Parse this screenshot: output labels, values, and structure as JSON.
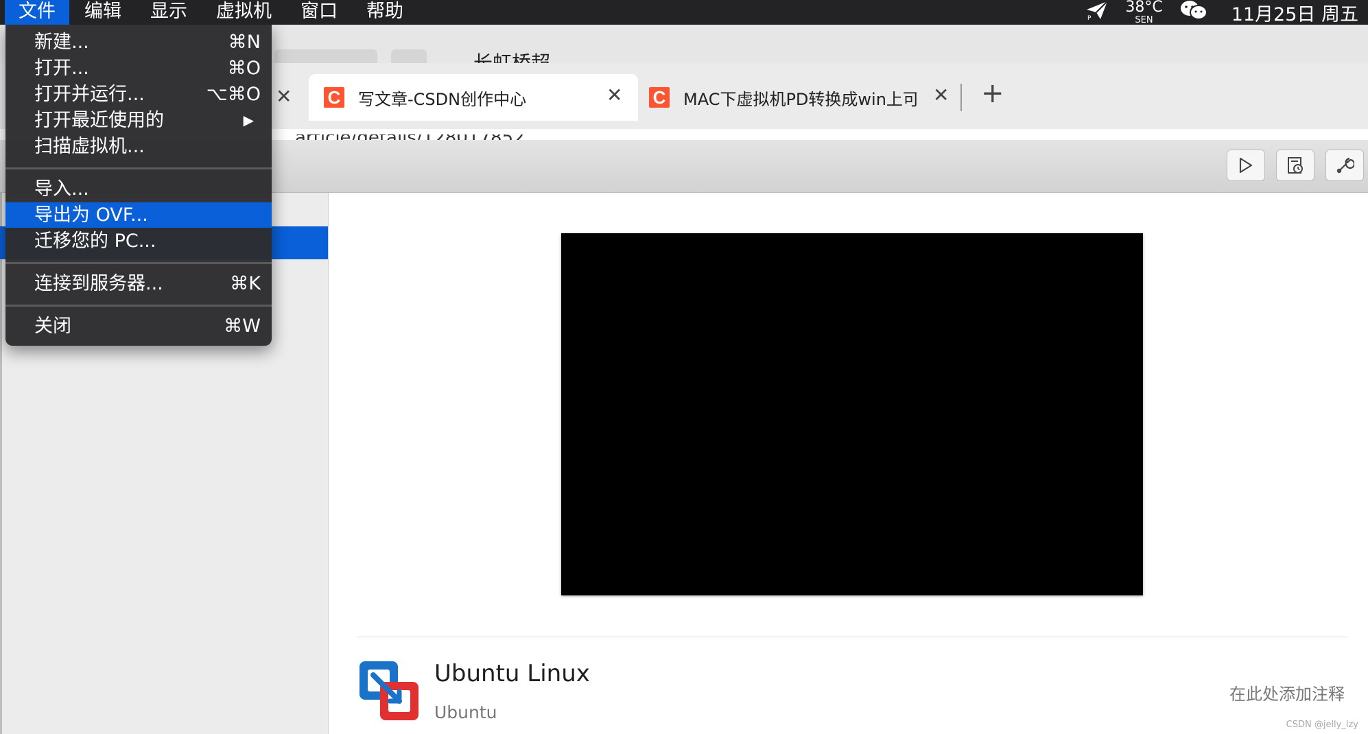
{
  "menubar": {
    "items": [
      "文件",
      "编辑",
      "显示",
      "虚拟机",
      "窗口",
      "帮助"
    ],
    "active_index": 0,
    "status": {
      "weather_temp": "38°C",
      "weather_loc": "SEN",
      "clock": "11月25日 周五"
    }
  },
  "file_menu": {
    "new": {
      "label": "新建...",
      "shortcut": "⌘N"
    },
    "open": {
      "label": "打开...",
      "shortcut": "⌘O"
    },
    "open_run": {
      "label": "打开并运行...",
      "shortcut": "⌥⌘O"
    },
    "open_recent": {
      "label": "打开最近使用的",
      "shortcut": "▶"
    },
    "scan": {
      "label": "扫描虚拟机..."
    },
    "import": {
      "label": "导入..."
    },
    "export_ovf": {
      "label": "导出为 OVF..."
    },
    "migrate": {
      "label": "迁移您的 PC..."
    },
    "connect_server": {
      "label": "连接到服务器...",
      "shortcut": "⌘K"
    },
    "close": {
      "label": "关闭",
      "shortcut": "⌘W"
    }
  },
  "browser": {
    "hidden_title": "长虹桥超",
    "url_fragment": "article/details/128017852",
    "tabs": [
      {
        "title": "写文章-CSDN创作中心",
        "active": true
      },
      {
        "title": "MAC下虚拟机PD转换成win上可",
        "active": false
      }
    ]
  },
  "vm": {
    "name": "Ubuntu Linux",
    "os": "Ubuntu",
    "notes_placeholder": "在此处添加注释"
  },
  "watermark": "CSDN @jelly_lzy",
  "colors": {
    "menubar_bg": "#232325",
    "selection_blue": "#0a60d9",
    "csdn_red": "#fc5531",
    "menu_bg": "#2c2c2e"
  }
}
